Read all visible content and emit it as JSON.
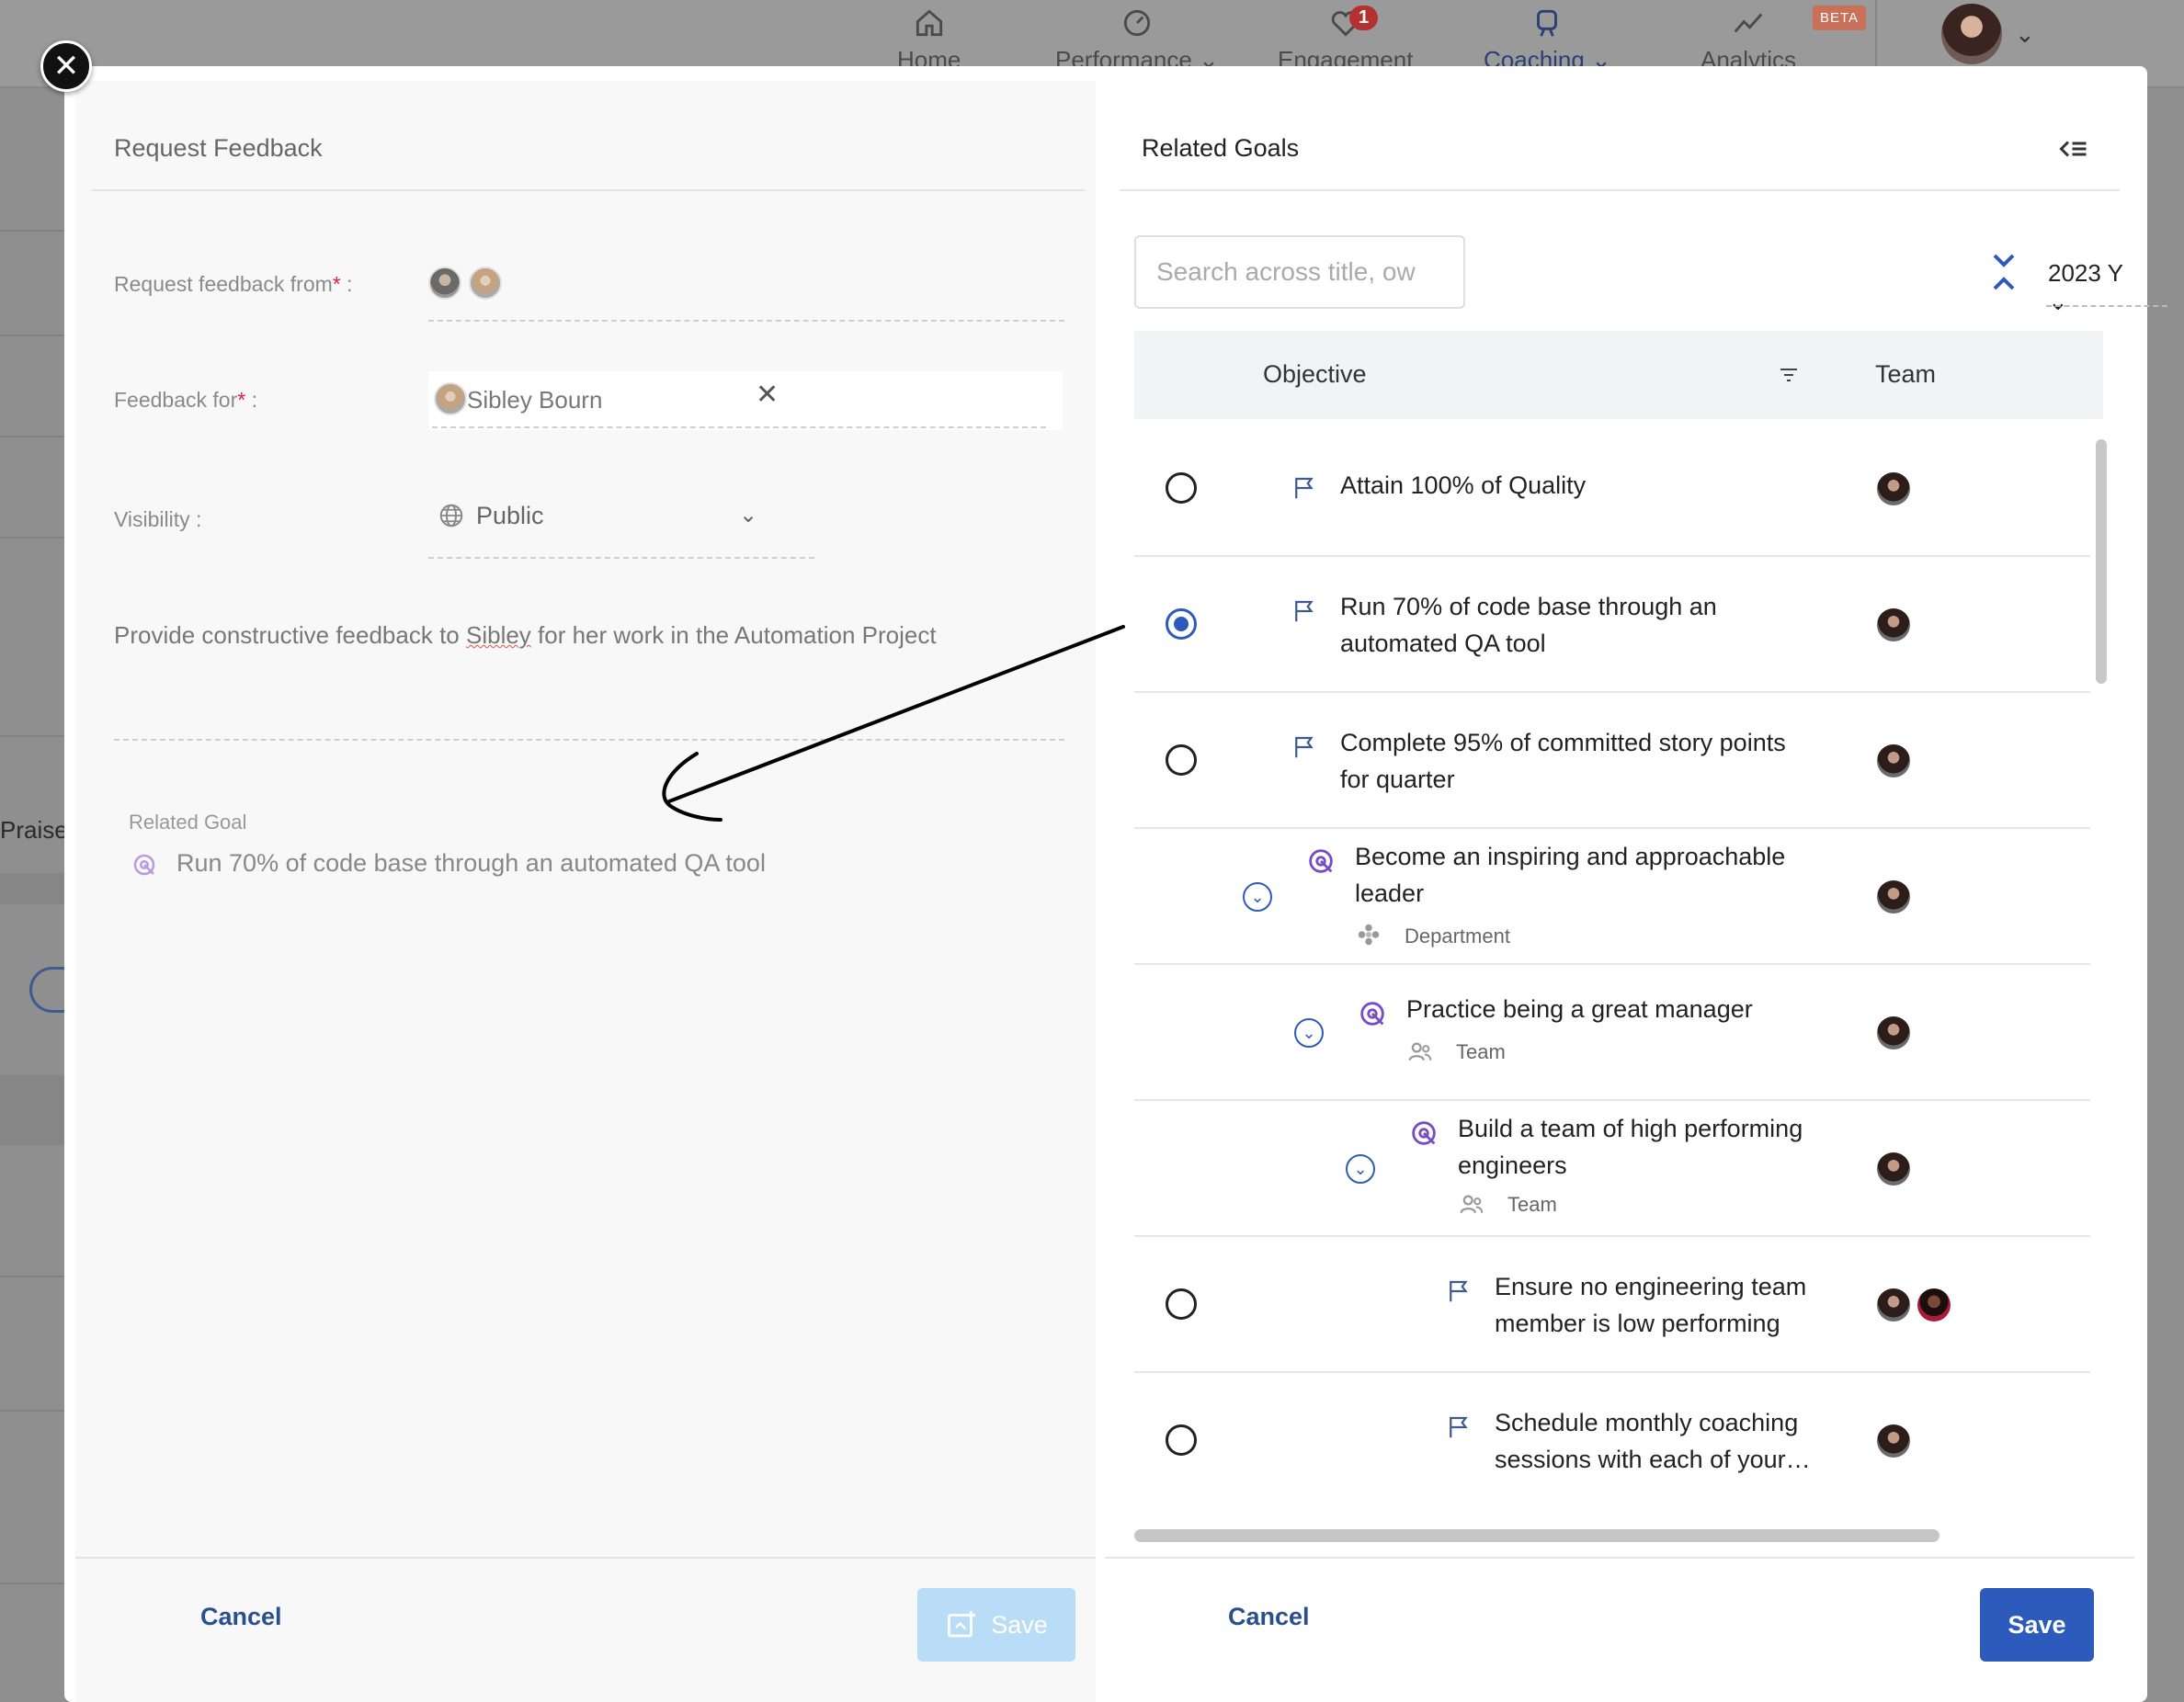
{
  "app_nav": {
    "items": [
      {
        "label": "Home",
        "icon": "home-icon"
      },
      {
        "label": "Performance",
        "icon": "gauge-icon",
        "has_dropdown": true
      },
      {
        "label": "Engagement",
        "icon": "heart-pulse-icon",
        "badge": "1"
      },
      {
        "label": "Coaching",
        "icon": "coaching-icon",
        "has_dropdown": true,
        "active": true
      },
      {
        "label": "Analytics",
        "icon": "analytics-icon",
        "badge": "BETA"
      }
    ],
    "bg_praises": "Praises"
  },
  "request_feedback": {
    "title": "Request Feedback",
    "from_label": "Request feedback from",
    "for_label": "Feedback for",
    "for_value": "Sibley Bourn",
    "visibility_label": "Visibility :",
    "visibility_value": "Public",
    "message_before": "Provide constructive feedback to ",
    "message_name": "Sibley",
    "message_after": " for her work in the Automation Project",
    "related_goal_label": "Related Goal",
    "related_goal_value": "Run 70% of code base through an automated QA tool",
    "cancel_label": "Cancel",
    "save_label": "Save"
  },
  "related_goals": {
    "title": "Related Goals",
    "search_placeholder": "Search across title, ow",
    "year": "2023 Y",
    "columns": {
      "objective": "Objective",
      "team": "Team"
    },
    "rows": [
      {
        "title": "Attain 100% of Quality",
        "type": "flag",
        "selected": false
      },
      {
        "title": "Run 70% of code base through an automated QA tool",
        "type": "flag",
        "selected": true
      },
      {
        "title": "Complete 95% of committed story points for quarter",
        "type": "flag",
        "selected": false
      },
      {
        "title": "Become an inspiring and approachable leader",
        "type": "goal",
        "sub": "Department"
      },
      {
        "title": "Practice being a great manager",
        "type": "goal",
        "sub": "Team"
      },
      {
        "title": "Build a team of high performing engineers",
        "type": "goal",
        "sub": "Team"
      },
      {
        "title": "Ensure no engineering team member is low performing",
        "type": "flag",
        "selected": false
      },
      {
        "title": "Schedule monthly coaching sessions with each of your…",
        "type": "flag",
        "selected": false
      }
    ],
    "cancel_label": "Cancel",
    "save_label": "Save"
  },
  "colors": {
    "primary": "#2d5bbb",
    "disabled": "#b9dcf7",
    "goal_purple": "#7b4bc4"
  }
}
